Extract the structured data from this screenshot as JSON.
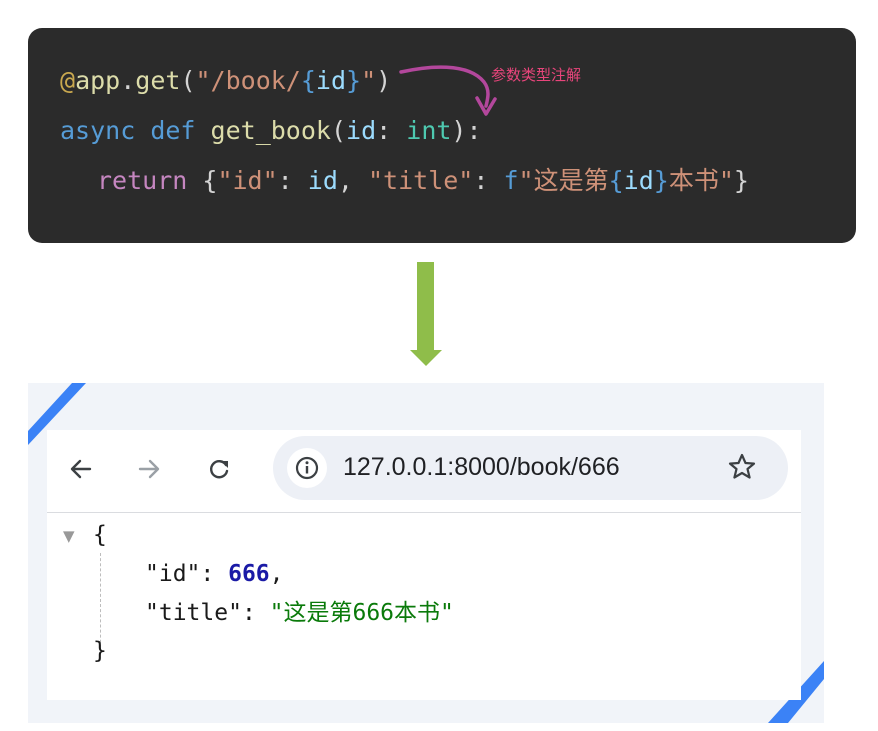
{
  "code": {
    "line1": {
      "decorator_at": "@",
      "obj": "app",
      "dot": ".",
      "method": "get",
      "open": "(",
      "quote_open": "\"/book/",
      "brace_open": "{",
      "param": "id",
      "brace_close": "}",
      "quote_close": "\"",
      "close": ")"
    },
    "line2": {
      "async_kw": "async",
      "def_kw": "def",
      "func_name": "get_book",
      "open": "(",
      "param": "id",
      "colon": ":",
      "type": "int",
      "close": "):"
    },
    "line3": {
      "return_kw": "return",
      "open_brace": "{",
      "key_id": "\"id\"",
      "colon1": ": ",
      "val_id": "id",
      "comma": ", ",
      "key_title": "\"title\"",
      "colon2": ": ",
      "fprefix": "f",
      "str_open": "\"这是第",
      "interp_open": "{",
      "interp_var": "id",
      "interp_close": "}",
      "str_close": "本书\"",
      "close_brace": "}"
    },
    "annotation": "参数类型注解"
  },
  "browser": {
    "back_icon": "back-arrow-icon",
    "forward_icon": "forward-arrow-icon",
    "reload_icon": "reload-icon",
    "info_icon": "info-icon",
    "star_icon": "star-icon",
    "url": "127.0.0.1:8000/book/666"
  },
  "response": {
    "open": "{",
    "close": "}",
    "id_key": "\"id\"",
    "id_value": "666",
    "title_key": "\"title\"",
    "title_value": "\"这是第666本书\""
  },
  "colors": {
    "code_bg": "#2b2b2b",
    "annotation": "#e8457b",
    "annotation_arrow": "#b3479c",
    "down_arrow": "#8fbd4a",
    "accent_corner": "#3b82f6",
    "json_number": "#1a1aa6",
    "json_string": "#0a7a0a"
  }
}
